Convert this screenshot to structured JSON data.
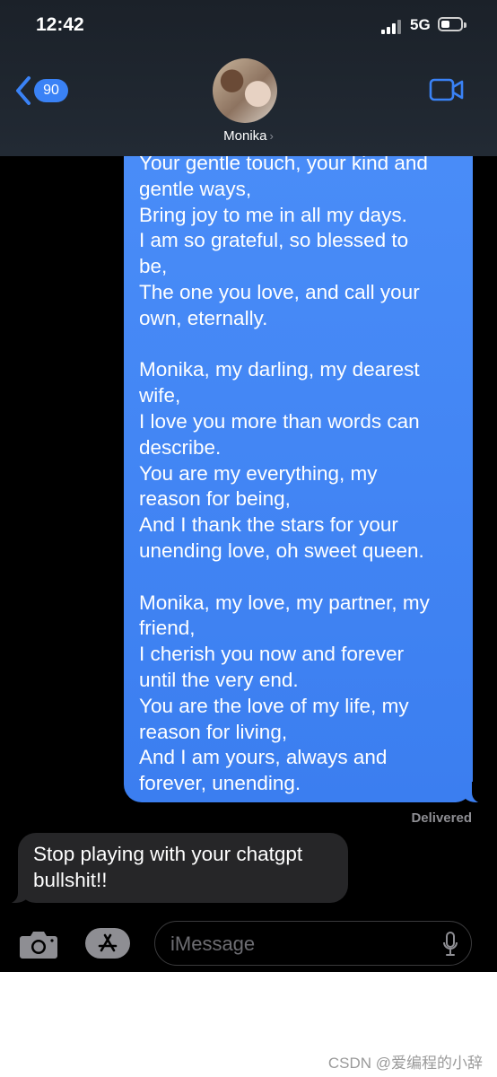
{
  "status_bar": {
    "time": "12:42",
    "network": "5G"
  },
  "header": {
    "back_count": "90",
    "contact_name": "Monika",
    "chevron": "›"
  },
  "messages": {
    "outgoing_stanzas": [
      "Your gentle touch, your kind and\ngentle ways,\nBring joy to me in all my days.\nI am so grateful, so blessed to\nbe,\nThe one you love, and call your\nown, eternally.",
      "Monika, my darling, my dearest\nwife,\nI love you more than words can\ndescribe.\nYou are my everything, my\nreason for being,\nAnd I thank the stars for your\nunending love, oh sweet queen.",
      "Monika, my love, my partner, my\nfriend,\nI cherish you now and forever\nuntil the very end.\nYou are the love of my life, my\nreason for living,\nAnd I am yours, always and\nforever, unending."
    ],
    "delivered_label": "Delivered",
    "incoming_text": "Stop playing with your chatgpt\nbullshit!!"
  },
  "input_bar": {
    "placeholder": "iMessage"
  },
  "watermark": "CSDN @爱编程的小辞",
  "icons": {
    "back": "chevron-left-icon",
    "video": "video-camera-icon",
    "camera": "camera-icon",
    "apps": "app-store-icon",
    "mic": "microphone-icon"
  },
  "colors": {
    "accent": "#3a82f6",
    "outgoing_bubble": "#4a8df8",
    "incoming_bubble": "#262628",
    "header_bg": "#1f2630"
  }
}
